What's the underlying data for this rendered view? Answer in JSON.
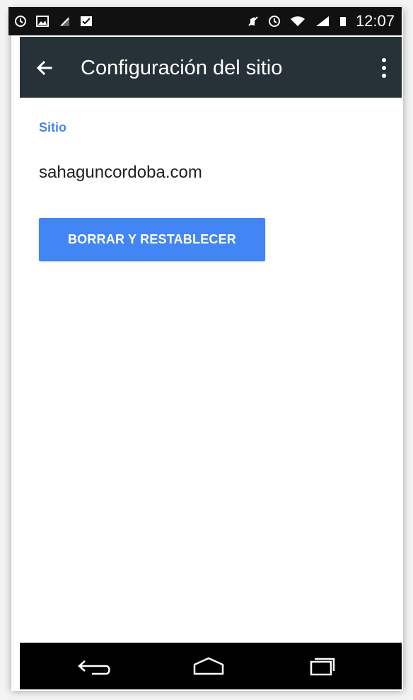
{
  "status_bar": {
    "time": "12:07",
    "left_icons": [
      "alarm-icon",
      "image-icon",
      "signal-off-icon",
      "clipboard-check-icon"
    ],
    "right_icons": [
      "mute-icon",
      "alarm-icon",
      "wifi-icon",
      "signal-icon",
      "battery-icon"
    ]
  },
  "toolbar": {
    "title": "Configuración del sitio",
    "back_icon": "arrow-left-icon",
    "menu_icon": "more-vert-icon"
  },
  "content": {
    "section_label": "Sitio",
    "site_name": "sahaguncordoba.com",
    "reset_button_label": "BORRAR Y RESTABLECER"
  },
  "nav_bar": {
    "icons": [
      "back-icon",
      "home-icon",
      "recents-icon"
    ]
  },
  "colors": {
    "toolbar": "#263238",
    "status_bar": "#111111",
    "accent": "#4a86e8",
    "button": "#4285f4",
    "nav_bar": "#000000"
  }
}
